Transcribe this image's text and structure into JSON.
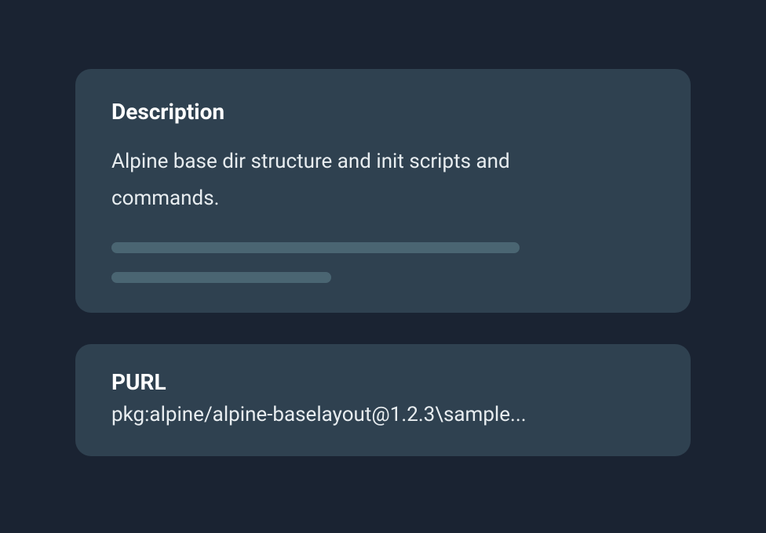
{
  "description": {
    "title": "Description",
    "text": "Alpine base dir structure and init scripts and commands."
  },
  "purl": {
    "title": "PURL",
    "value": "pkg:alpine/alpine-baselayout@1.2.3\\sample..."
  }
}
